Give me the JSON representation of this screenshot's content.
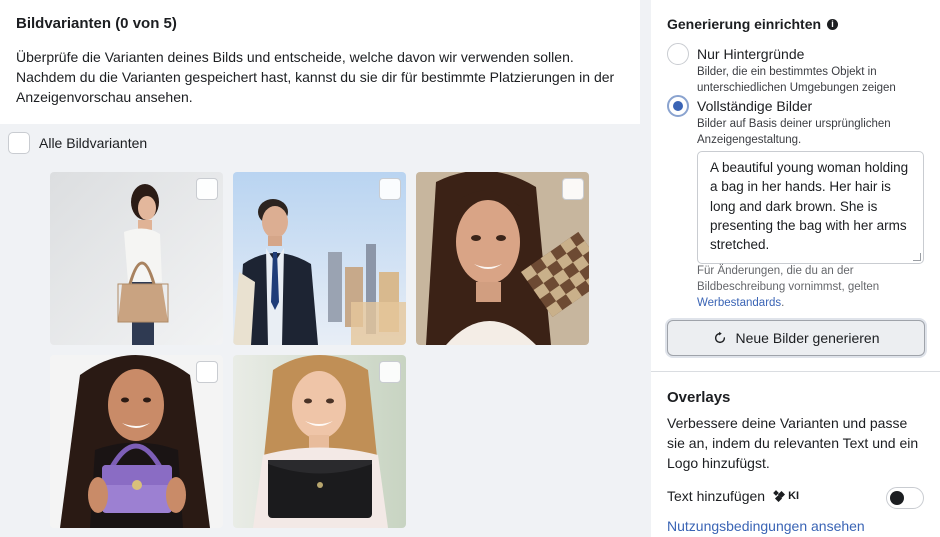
{
  "variants": {
    "title": "Bildvarianten (0 von 5)",
    "description": "Überprüfe die Varianten deines Bilds und entscheide, welche davon wir verwenden sollen. Nachdem du die Varianten gespeichert hast, kannst du sie dir für bestimmte Platzierungen in der Anzeigenvorschau ansehen.",
    "select_all_label": "Alle Bildvarianten",
    "images": [
      {
        "subject": "woman-profile-tote-bag"
      },
      {
        "subject": "businessman-city"
      },
      {
        "subject": "woman-checkered-bag"
      },
      {
        "subject": "woman-purple-bag"
      },
      {
        "subject": "woman-black-clutch"
      }
    ]
  },
  "generation": {
    "title": "Generierung einrichten",
    "option_backgrounds": {
      "label": "Nur Hintergründe",
      "sub": "Bilder, die ein bestimmtes Objekt in unterschiedlichen Umgebungen zeigen",
      "selected": false
    },
    "option_full": {
      "label": "Vollständige Bilder",
      "sub": "Bilder auf Basis deiner ursprünglichen Anzeigengestaltung.",
      "selected": true
    },
    "prompt_text": "A beautiful young woman holding a bag in her hands. Her hair is long and dark brown. She is presenting the bag with her arms stretched.",
    "note_text": "Für Änderungen, die du an der Bildbeschreibung vornimmst, gelten",
    "note_link": "Werbestandards",
    "note_end": ".",
    "generate_button": "Neue Bilder generieren"
  },
  "overlays": {
    "title": "Overlays",
    "description": "Verbessere deine Varianten und passe sie an, indem du relevanten Text und ein Logo hinzufügst.",
    "text_add_label": "Text hinzufügen",
    "ai_badge": "KI",
    "text_toggle_on": false,
    "terms_link": "Nutzungsbedingungen ansehen"
  },
  "colors": {
    "accent": "#3a64b5",
    "panel": "#ffffff",
    "background": "#f0f2f5"
  }
}
